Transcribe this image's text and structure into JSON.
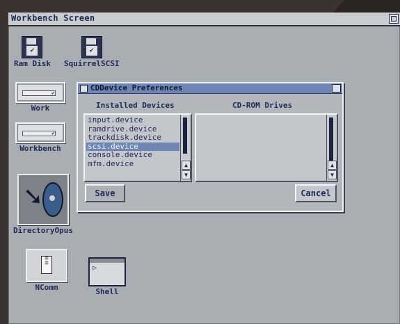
{
  "screen": {
    "title": "Workbench Screen"
  },
  "icons": {
    "ram_disk": "Ram Disk",
    "squirrel": "SquirrelSCSI",
    "work": "Work",
    "workbench": "Workbench",
    "dopus": "DirectoryOpus",
    "ncomm": "NComm",
    "shell": "Shell"
  },
  "window": {
    "title": "CDDevice Preferences",
    "installed_heading": "Installed Devices",
    "cdrom_heading": "CD-ROM Drives",
    "installed_devices": [
      "input.device",
      "ramdrive.device",
      "trackdisk.device",
      "scsi.device",
      "console.device",
      "mfm.device"
    ],
    "selected_device": "scsi.device",
    "cdrom_drives": [],
    "save_label": "Save",
    "cancel_label": "Cancel"
  }
}
